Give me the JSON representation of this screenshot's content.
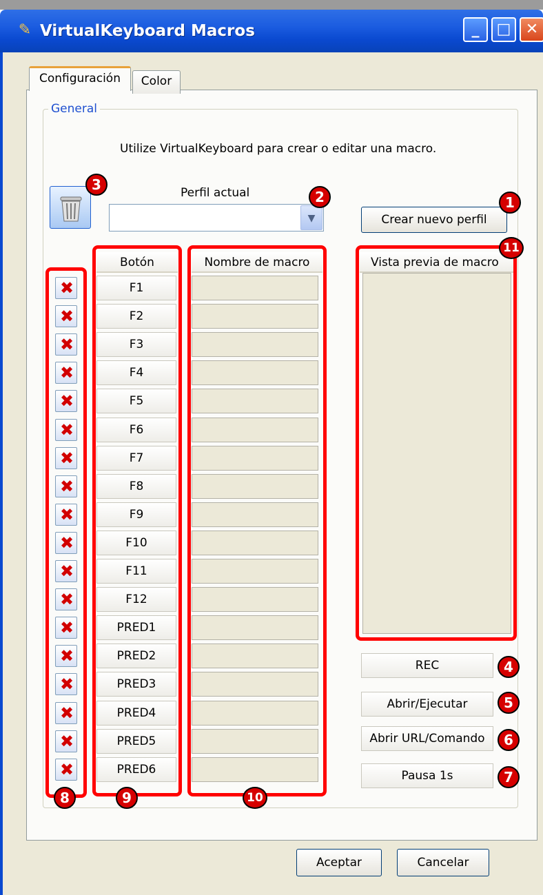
{
  "window": {
    "title": "VirtualKeyboard Macros",
    "minimize_label": "_",
    "maximize_label": "□",
    "close_label": "✕"
  },
  "tabs": [
    {
      "label": "Configuración",
      "active": true
    },
    {
      "label": "Color",
      "active": false
    }
  ],
  "group": {
    "label": "General",
    "instruction": "Utilize VirtualKeyboard para crear o editar una macro."
  },
  "profile": {
    "label": "Perfil actual",
    "value": "",
    "create_button": "Crear nuevo perfil"
  },
  "table": {
    "header_button": "Botón",
    "header_name": "Nombre de macro",
    "rows": [
      {
        "button": "F1",
        "name": ""
      },
      {
        "button": "F2",
        "name": ""
      },
      {
        "button": "F3",
        "name": ""
      },
      {
        "button": "F4",
        "name": ""
      },
      {
        "button": "F5",
        "name": ""
      },
      {
        "button": "F6",
        "name": ""
      },
      {
        "button": "F7",
        "name": ""
      },
      {
        "button": "F8",
        "name": ""
      },
      {
        "button": "F9",
        "name": ""
      },
      {
        "button": "F10",
        "name": ""
      },
      {
        "button": "F11",
        "name": ""
      },
      {
        "button": "F12",
        "name": ""
      },
      {
        "button": "PRED1",
        "name": ""
      },
      {
        "button": "PRED2",
        "name": ""
      },
      {
        "button": "PRED3",
        "name": ""
      },
      {
        "button": "PRED4",
        "name": ""
      },
      {
        "button": "PRED5",
        "name": ""
      },
      {
        "button": "PRED6",
        "name": ""
      }
    ]
  },
  "preview": {
    "header": "Vista previa de macro"
  },
  "side_buttons": {
    "rec": "REC",
    "open_execute": "Abrir/Ejecutar",
    "open_url": "Abrir URL/Comando",
    "pause": "Pausa 1s"
  },
  "footer": {
    "accept": "Aceptar",
    "cancel": "Cancelar"
  },
  "annotations": {
    "b1": "1",
    "b2": "2",
    "b3": "3",
    "b4": "4",
    "b5": "5",
    "b6": "6",
    "b7": "7",
    "b8": "8",
    "b9": "9",
    "b10": "10",
    "b11": "11"
  },
  "colors": {
    "titlebar": "#0a49d0",
    "annotation_red": "#ff0000",
    "badge_red": "#d60000",
    "delete_x": "#d20000",
    "group_label": "#1f50d0"
  },
  "icons": {
    "app": "keyboard-pen-icon",
    "trash": "trash-can-icon",
    "delete": "red-x-icon",
    "dropdown": "chevron-down-icon"
  }
}
